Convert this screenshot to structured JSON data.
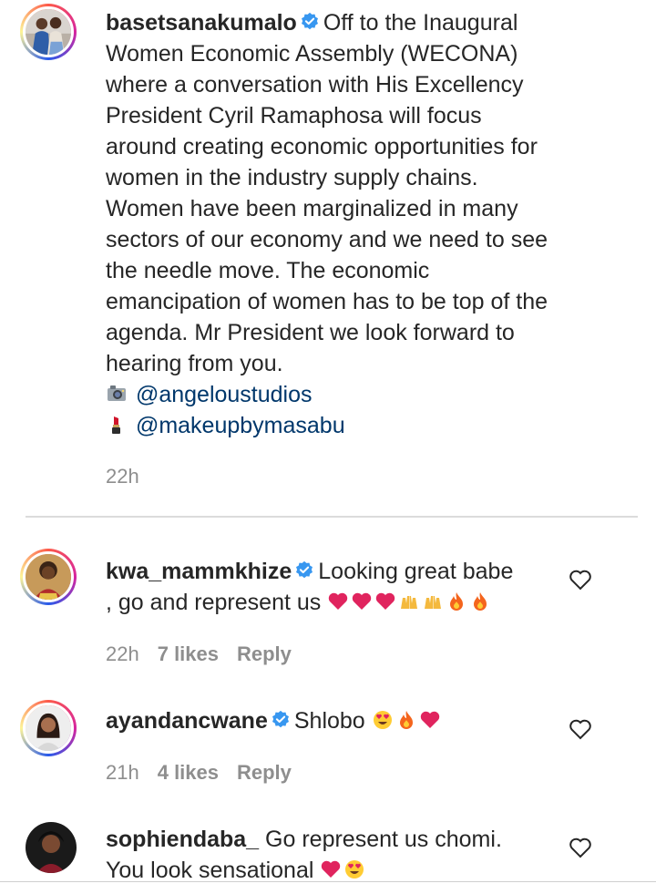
{
  "caption": {
    "username": "basetsanakumalo",
    "lines": [
      "Off to the Inaugural",
      "Women Economic Assembly (WECONA)",
      "where a conversation with His Excellency",
      "President Cyril Ramaphosa will focus",
      "around creating economic opportunities for",
      "women in the industry supply chains.",
      "Women have been marginalized in many",
      "sectors of our economy and we need to see",
      "the needle move. The economic",
      "emancipation of women has to be top of the",
      "agenda. Mr President we look forward to",
      "hearing from you."
    ],
    "credit_1": "@angeloustudios",
    "credit_2": "@makeupbymasabu",
    "time": "22h"
  },
  "comments": [
    {
      "username": "kwa_mammkhize",
      "text_line_1": "Looking great babe",
      "text_line_2": ", go and represent us",
      "time": "22h",
      "likes": "7 likes",
      "reply": "Reply"
    },
    {
      "username": "ayandancwane",
      "text_line_1": "Shlobo",
      "time": "21h",
      "likes": "4 likes",
      "reply": "Reply"
    },
    {
      "username": "sophiendaba_",
      "text_line_1": "Go represent us chomi.",
      "text_line_2": "You look sensational"
    }
  ],
  "icons": {
    "verified": "verified-badge-icon",
    "heart": "heart-outline-icon",
    "camera": "camera-icon",
    "lipstick": "lipstick-icon"
  },
  "colors": {
    "verified_blue": "#3897f0",
    "mention": "#00376b",
    "meta_gray": "#8e8e8e",
    "text": "#262626"
  }
}
